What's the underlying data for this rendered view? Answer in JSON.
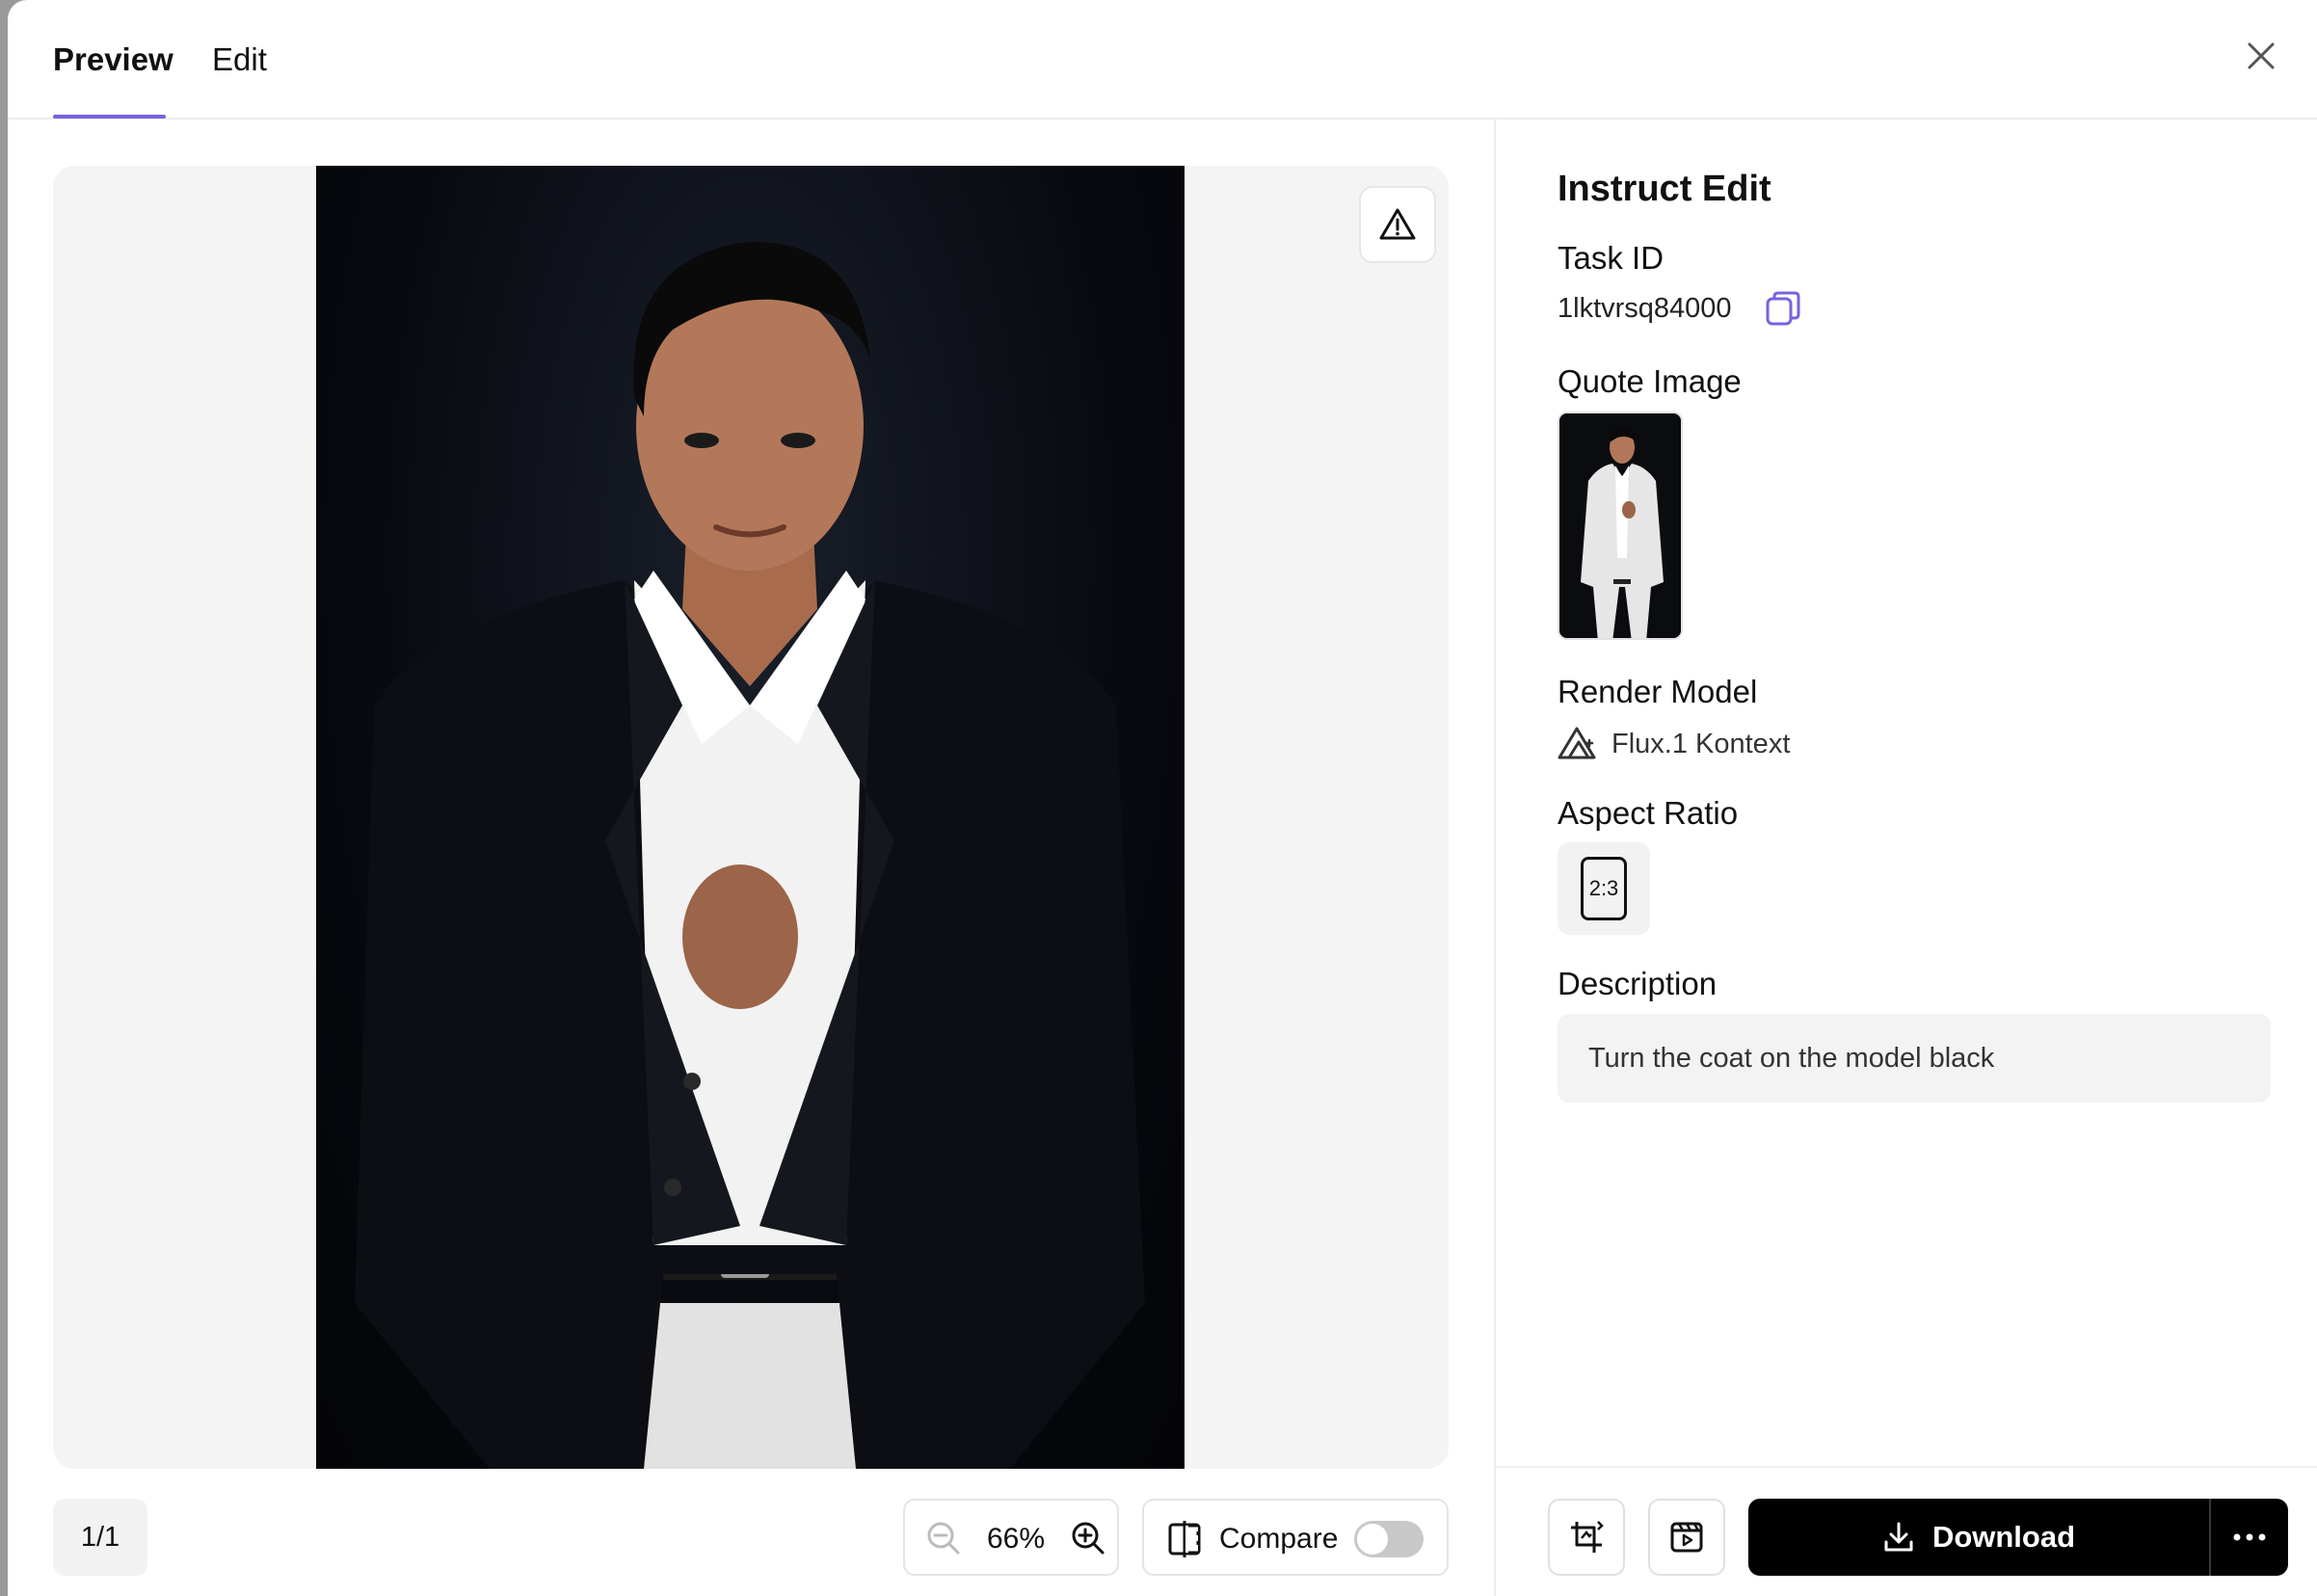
{
  "header": {
    "tabs": [
      {
        "label": "Preview",
        "active": true
      },
      {
        "label": "Edit",
        "active": false
      }
    ]
  },
  "preview": {
    "page_counter": "1/1",
    "zoom_level": "66%",
    "compare_label": "Compare",
    "compare_enabled": false
  },
  "panel": {
    "title": "Instruct Edit",
    "task_id_label": "Task ID",
    "task_id": "1lktvrsq84000",
    "quote_image_label": "Quote Image",
    "render_model_label": "Render Model",
    "render_model": "Flux.1 Kontext",
    "aspect_ratio_label": "Aspect Ratio",
    "aspect_ratio": "2:3",
    "description_label": "Description",
    "description": "Turn the coat on the model black"
  },
  "actions": {
    "download_label": "Download"
  },
  "icons": {
    "close": "close-icon",
    "report": "warning-triangle-icon",
    "zoom_out": "zoom-out-icon",
    "zoom_in": "zoom-in-icon",
    "compare": "compare-split-icon",
    "copy": "copy-icon",
    "model": "flux-logo-icon",
    "crop": "crop-rotate-icon",
    "video": "video-play-icon",
    "download": "download-icon",
    "more": "more-horizontal-icon"
  },
  "colors": {
    "accent": "#7663e0",
    "primary_button": "#000000"
  }
}
